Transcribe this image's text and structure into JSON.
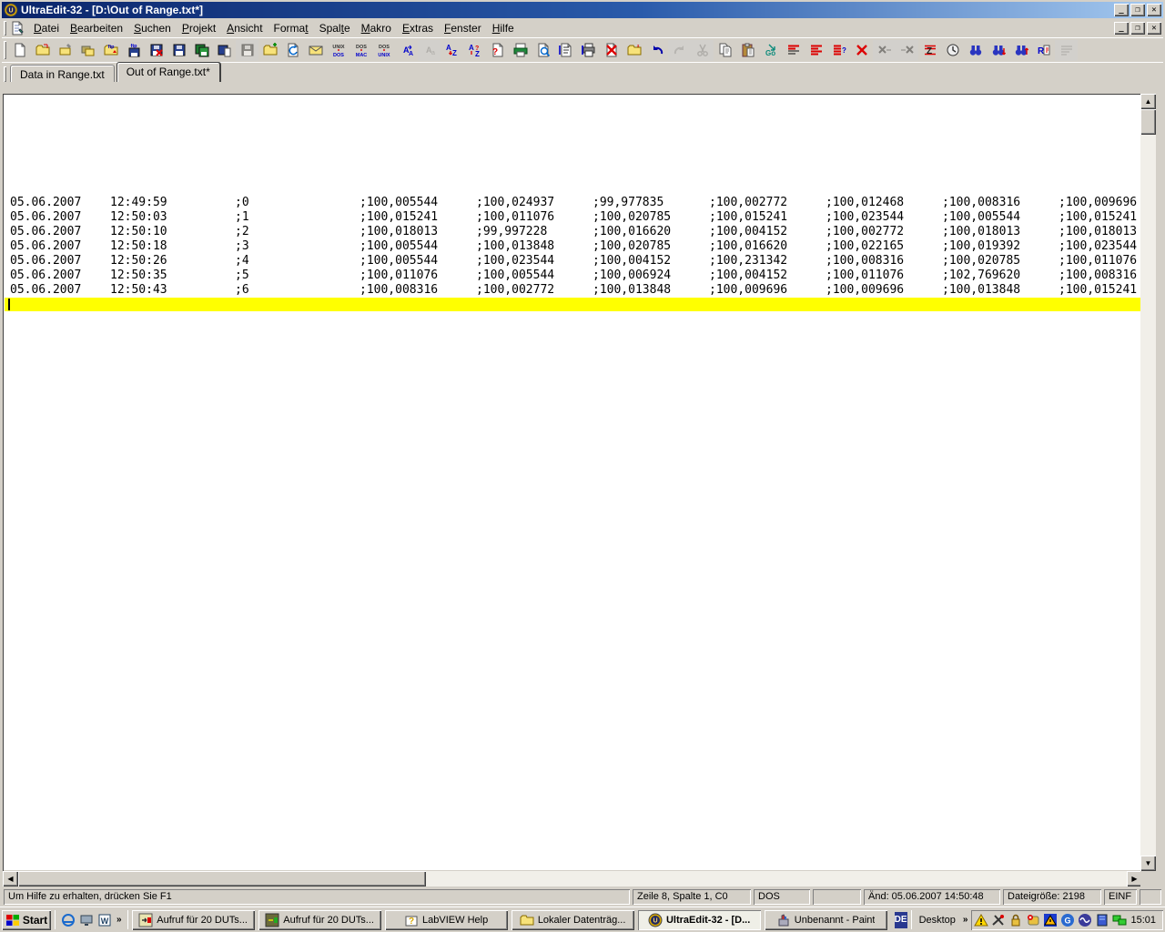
{
  "window": {
    "title": "UltraEdit-32 - [D:\\Out of Range.txt*]"
  },
  "menubar": {
    "items": [
      {
        "label": "Datei",
        "accel": 0
      },
      {
        "label": "Bearbeiten",
        "accel": 0
      },
      {
        "label": "Suchen",
        "accel": 0
      },
      {
        "label": "Projekt",
        "accel": 0
      },
      {
        "label": "Ansicht",
        "accel": 0
      },
      {
        "label": "Format",
        "accel": 5
      },
      {
        "label": "Spalte",
        "accel": 4
      },
      {
        "label": "Makro",
        "accel": 0
      },
      {
        "label": "Extras",
        "accel": 0
      },
      {
        "label": "Fenster",
        "accel": 0
      },
      {
        "label": "Hilfe",
        "accel": 0
      }
    ]
  },
  "toolbar": {
    "icons": [
      {
        "name": "new-file"
      },
      {
        "name": "open-file"
      },
      {
        "name": "close-file"
      },
      {
        "name": "close-all"
      },
      {
        "name": "ftp-open"
      },
      {
        "name": "ftp-save"
      },
      {
        "name": "save-close"
      },
      {
        "name": "save"
      },
      {
        "name": "save-all"
      },
      {
        "name": "save-as"
      },
      {
        "name": "save-copy",
        "disabled": true
      },
      {
        "name": "add-favorite"
      },
      {
        "name": "revert-file"
      },
      {
        "name": "send-mail"
      },
      {
        "name": "unix-to-dos"
      },
      {
        "name": "dos-to-mac"
      },
      {
        "name": "dos-to-unix"
      },
      {
        "name": "to-uppercase"
      },
      {
        "name": "to-lowercase",
        "disabled": true
      },
      {
        "name": "sort-ascending"
      },
      {
        "name": "sort-options"
      },
      {
        "name": "spell-check"
      },
      {
        "name": "print"
      },
      {
        "name": "print-preview"
      },
      {
        "name": "page-setup"
      },
      {
        "name": "print-setup"
      },
      {
        "name": "delete-file"
      },
      {
        "name": "open-recent"
      },
      {
        "name": "undo"
      },
      {
        "name": "redo",
        "disabled": true
      },
      {
        "name": "cut",
        "disabled": true
      },
      {
        "name": "copy"
      },
      {
        "name": "paste"
      },
      {
        "name": "goto-line"
      },
      {
        "name": "format-left"
      },
      {
        "name": "format-right"
      },
      {
        "name": "format-help"
      },
      {
        "name": "delete-line"
      },
      {
        "name": "delete-to-eol",
        "disabled": true
      },
      {
        "name": "delete-to-bol",
        "disabled": true
      },
      {
        "name": "template"
      },
      {
        "name": "insert-time"
      },
      {
        "name": "find"
      },
      {
        "name": "find-next"
      },
      {
        "name": "find-prev"
      },
      {
        "name": "replace"
      },
      {
        "name": "wrap",
        "disabled": true
      }
    ]
  },
  "tabs": [
    {
      "label": "Data in Range.txt",
      "active": false
    },
    {
      "label": "Out of Range.txt*",
      "active": true
    }
  ],
  "editor": {
    "highlighted_line": 8,
    "rows": [
      {
        "cols": [
          "05.06.2007",
          "12:49:59",
          ";0",
          ";100,005544",
          ";100,024937",
          ";99,977835",
          ";100,002772",
          ";100,012468",
          ";100,008316",
          ";100,009696"
        ]
      },
      {
        "cols": [
          "05.06.2007",
          "12:50:03",
          ";1",
          ";100,015241",
          ";100,011076",
          ";100,020785",
          ";100,015241",
          ";100,023544",
          ";100,005544",
          ";100,015241"
        ]
      },
      {
        "cols": [
          "05.06.2007",
          "12:50:10",
          ";2",
          ";100,018013",
          ";99,997228",
          ";100,016620",
          ";100,004152",
          ";100,002772",
          ";100,018013",
          ";100,018013"
        ]
      },
      {
        "cols": [
          "05.06.2007",
          "12:50:18",
          ";3",
          ";100,005544",
          ";100,013848",
          ";100,020785",
          ";100,016620",
          ";100,022165",
          ";100,019392",
          ";100,023544"
        ]
      },
      {
        "cols": [
          "05.06.2007",
          "12:50:26",
          ";4",
          ";100,005544",
          ";100,023544",
          ";100,004152",
          ";100,231342",
          ";100,008316",
          ";100,020785",
          ";100,011076"
        ]
      },
      {
        "cols": [
          "05.06.2007",
          "12:50:35",
          ";5",
          ";100,011076",
          ";100,005544",
          ";100,006924",
          ";100,004152",
          ";100,011076",
          ";102,769620",
          ";100,008316"
        ]
      },
      {
        "cols": [
          "05.06.2007",
          "12:50:43",
          ";6",
          ";100,008316",
          ";100,002772",
          ";100,013848",
          ";100,009696",
          ";100,009696",
          ";100,013848",
          ";100,015241"
        ]
      }
    ]
  },
  "statusbar": {
    "message": "Um Hilfe zu erhalten, drücken Sie F1",
    "position": "Zeile 8, Spalte 1, C0",
    "file_format": "DOS",
    "modified": "Änd: 05.06.2007 14:50:48",
    "file_size": "Dateigröße: 2198",
    "insert_mode": "EINF"
  },
  "taskbar": {
    "start_label": "Start",
    "quicklaunch": [
      "ie",
      "show-desktop",
      "word"
    ],
    "overflow_chevron": "»",
    "buttons": [
      {
        "label": "Aufruf für 20 DUTs...",
        "icon": "labview-vi",
        "active": false
      },
      {
        "label": "Aufruf für 20 DUTs...",
        "icon": "labview-vi2",
        "active": false
      },
      {
        "label": "LabVIEW Help",
        "icon": "help-book",
        "active": false
      },
      {
        "label": "Lokaler Datenträg...",
        "icon": "folder-small",
        "active": false
      },
      {
        "label": "UltraEdit-32 - [D...",
        "icon": "ultraedit",
        "active": true
      },
      {
        "label": "Unbenannt - Paint",
        "icon": "paint",
        "active": false
      }
    ],
    "language_indicator": "DE",
    "desktop_label": "Desktop",
    "tray": [
      "tray-warn",
      "tray-usb",
      "tray-lock",
      "tray-mail",
      "tray-alert",
      "tray-q",
      "tray-wave",
      "tray-book",
      "tray-net"
    ],
    "clock": "15:01"
  },
  "colors": {
    "title_gradient_start": "#0a246a",
    "title_gradient_end": "#a6caf0",
    "chrome": "#d4d0c8",
    "highlight_line": "#ffff00",
    "language_badge": "#29388f"
  }
}
